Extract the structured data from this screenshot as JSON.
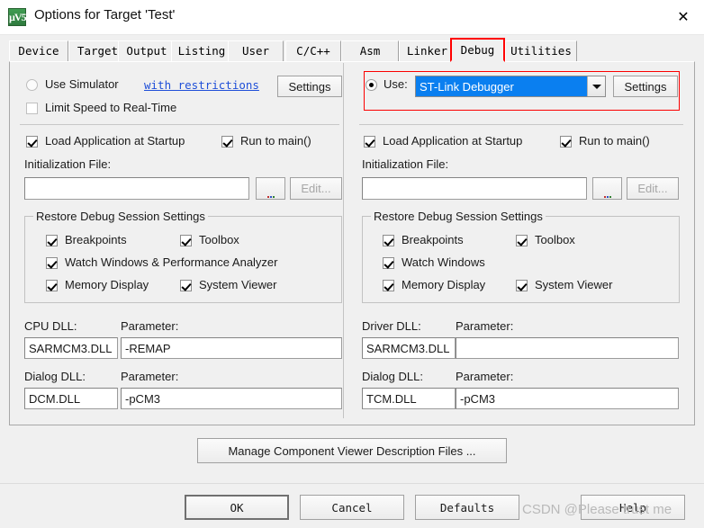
{
  "window": {
    "title": "Options for Target 'Test'",
    "icon": "keil-uvision-icon",
    "icon_glyph": "µV5",
    "close_icon": "✕"
  },
  "tabs": [
    {
      "label": "Device",
      "active": false
    },
    {
      "label": "Target",
      "active": false
    },
    {
      "label": "Output",
      "active": false
    },
    {
      "label": "Listing",
      "active": false
    },
    {
      "label": "User",
      "active": false
    },
    {
      "label": "C/C++",
      "active": false
    },
    {
      "label": "Asm",
      "active": false
    },
    {
      "label": "Linker",
      "active": false
    },
    {
      "label": "Debug",
      "active": true
    },
    {
      "label": "Utilities",
      "active": false
    }
  ],
  "simulator_panel": {
    "use_simulator_label": "Use Simulator",
    "use_simulator_checked": false,
    "with_restrictions_link": "with restrictions",
    "settings_button": "Settings",
    "limit_speed_label": "Limit Speed to Real-Time",
    "limit_speed_checked": false,
    "load_app_label": "Load Application at Startup",
    "load_app_checked": true,
    "run_to_main_label": "Run to main()",
    "run_to_main_checked": true,
    "init_file_label": "Initialization File:",
    "init_file_value": "",
    "browse_button": "...",
    "edit_button": "Edit...",
    "edit_button_disabled": true,
    "restore_group_title": "Restore Debug Session Settings",
    "restore_items": [
      {
        "label": "Breakpoints",
        "checked": true
      },
      {
        "label": "Toolbox",
        "checked": true
      },
      {
        "label": "Watch Windows & Performance Analyzer",
        "checked": true
      },
      {
        "label": "Memory Display",
        "checked": true
      },
      {
        "label": "System Viewer",
        "checked": true
      }
    ],
    "cpu_dll_label": "CPU DLL:",
    "cpu_dll_value": "SARMCM3.DLL",
    "cpu_param_label": "Parameter:",
    "cpu_param_value": "-REMAP",
    "dialog_dll_label": "Dialog DLL:",
    "dialog_dll_value": "DCM.DLL",
    "dialog_param_label": "Parameter:",
    "dialog_param_value": "-pCM3"
  },
  "debugger_panel": {
    "use_label": "Use:",
    "use_checked": true,
    "debugger_selected": "ST-Link Debugger",
    "dropdown_icon": "chevron-down-icon",
    "settings_button": "Settings",
    "load_app_label": "Load Application at Startup",
    "load_app_checked": true,
    "run_to_main_label": "Run to main()",
    "run_to_main_checked": true,
    "init_file_label": "Initialization File:",
    "init_file_value": "",
    "browse_button": "...",
    "edit_button": "Edit...",
    "edit_button_disabled": true,
    "restore_group_title": "Restore Debug Session Settings",
    "restore_items": [
      {
        "label": "Breakpoints",
        "checked": true
      },
      {
        "label": "Toolbox",
        "checked": true
      },
      {
        "label": "Watch Windows",
        "checked": true
      },
      {
        "label": "Memory Display",
        "checked": true
      },
      {
        "label": "System Viewer",
        "checked": true
      }
    ],
    "driver_dll_label": "Driver DLL:",
    "driver_dll_value": "SARMCM3.DLL",
    "driver_param_label": "Parameter:",
    "driver_param_value": "",
    "dialog_dll_label": "Dialog DLL:",
    "dialog_dll_value": "TCM.DLL",
    "dialog_param_label": "Parameter:",
    "dialog_param_value": "-pCM3"
  },
  "manage_button": "Manage Component Viewer Description Files ...",
  "footer_buttons": {
    "ok": "OK",
    "cancel": "Cancel",
    "defaults": "Defaults",
    "help": "Help"
  },
  "watermark": "CSDN @Please trust me",
  "colors": {
    "dialog_background": "#f0f0f0",
    "annotation_red": "#fb0000",
    "selection_blue": "#0a7ff0",
    "link_blue": "#1f4fd8",
    "watermark_gray": "#b9b9b9"
  }
}
